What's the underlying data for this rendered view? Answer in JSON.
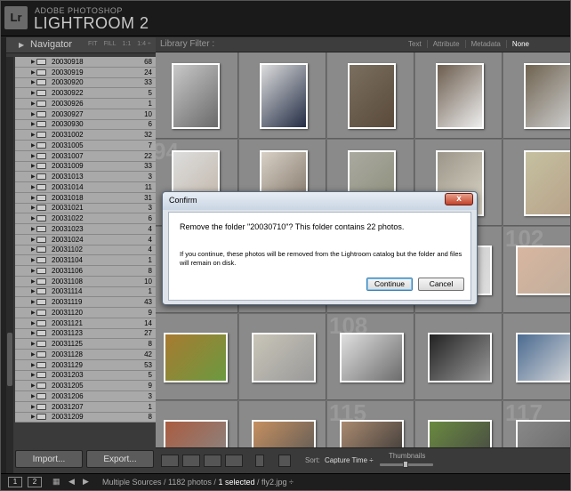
{
  "app": {
    "logo_text": "Lr",
    "brand_small": "ADOBE PHOTOSHOP",
    "brand_big": "LIGHTROOM 2"
  },
  "navigator": {
    "title": "Navigator",
    "options": [
      "FIT",
      "FILL",
      "1:1",
      "1:4 ÷"
    ]
  },
  "folders": [
    {
      "name": "20030918",
      "count": "68"
    },
    {
      "name": "20030919",
      "count": "24"
    },
    {
      "name": "20030920",
      "count": "33"
    },
    {
      "name": "20030922",
      "count": "5"
    },
    {
      "name": "20030926",
      "count": "1"
    },
    {
      "name": "20030927",
      "count": "10"
    },
    {
      "name": "20030930",
      "count": "6"
    },
    {
      "name": "20031002",
      "count": "32"
    },
    {
      "name": "20031005",
      "count": "7"
    },
    {
      "name": "20031007",
      "count": "22"
    },
    {
      "name": "20031009",
      "count": "33"
    },
    {
      "name": "20031013",
      "count": "3"
    },
    {
      "name": "20031014",
      "count": "11"
    },
    {
      "name": "20031018",
      "count": "31"
    },
    {
      "name": "20031021",
      "count": "3"
    },
    {
      "name": "20031022",
      "count": "6"
    },
    {
      "name": "20031023",
      "count": "4"
    },
    {
      "name": "20031024",
      "count": "4"
    },
    {
      "name": "20031102",
      "count": "4"
    },
    {
      "name": "20031104",
      "count": "1"
    },
    {
      "name": "20031106",
      "count": "8"
    },
    {
      "name": "20031108",
      "count": "10"
    },
    {
      "name": "20031114",
      "count": "1"
    },
    {
      "name": "20031119",
      "count": "43"
    },
    {
      "name": "20031120",
      "count": "9"
    },
    {
      "name": "20031121",
      "count": "14"
    },
    {
      "name": "20031123",
      "count": "27"
    },
    {
      "name": "20031125",
      "count": "8"
    },
    {
      "name": "20031128",
      "count": "42"
    },
    {
      "name": "20031129",
      "count": "53"
    },
    {
      "name": "20031203",
      "count": "5"
    },
    {
      "name": "20031205",
      "count": "9"
    },
    {
      "name": "20031206",
      "count": "3"
    },
    {
      "name": "20031207",
      "count": "1"
    },
    {
      "name": "20031209",
      "count": "8"
    }
  ],
  "left_buttons": {
    "import": "Import...",
    "export": "Export..."
  },
  "filter": {
    "label": "Library Filter :",
    "options": [
      "Text",
      "Attribute",
      "Metadata",
      "None"
    ],
    "active": "None"
  },
  "grid": {
    "cell_numbers": [
      "",
      "",
      "",
      "",
      "",
      "94",
      "",
      "",
      "",
      "",
      "",
      "",
      "",
      "",
      "102",
      "",
      "",
      "108",
      "",
      "",
      "",
      "",
      "115",
      "",
      "117"
    ]
  },
  "toolbar": {
    "sort_label": "Sort:",
    "sort_value": "Capture Time ÷",
    "thumbnails_label": "Thumbnails"
  },
  "statusbar": {
    "monitor1": "1",
    "monitor2": "2",
    "sources": "Multiple Sources /",
    "photos": "1182 photos /",
    "selected": "1 selected",
    "file": "/ fly2.jpg ÷"
  },
  "dialog": {
    "title": "Confirm",
    "close_glyph": "x",
    "message": "Remove the folder \"20030710\"? This folder contains 22 photos.",
    "detail": "If you continue, these photos will be removed from the Lightroom catalog but the folder and files will remain on disk.",
    "continue_label": "Continue",
    "cancel_label": "Cancel"
  }
}
